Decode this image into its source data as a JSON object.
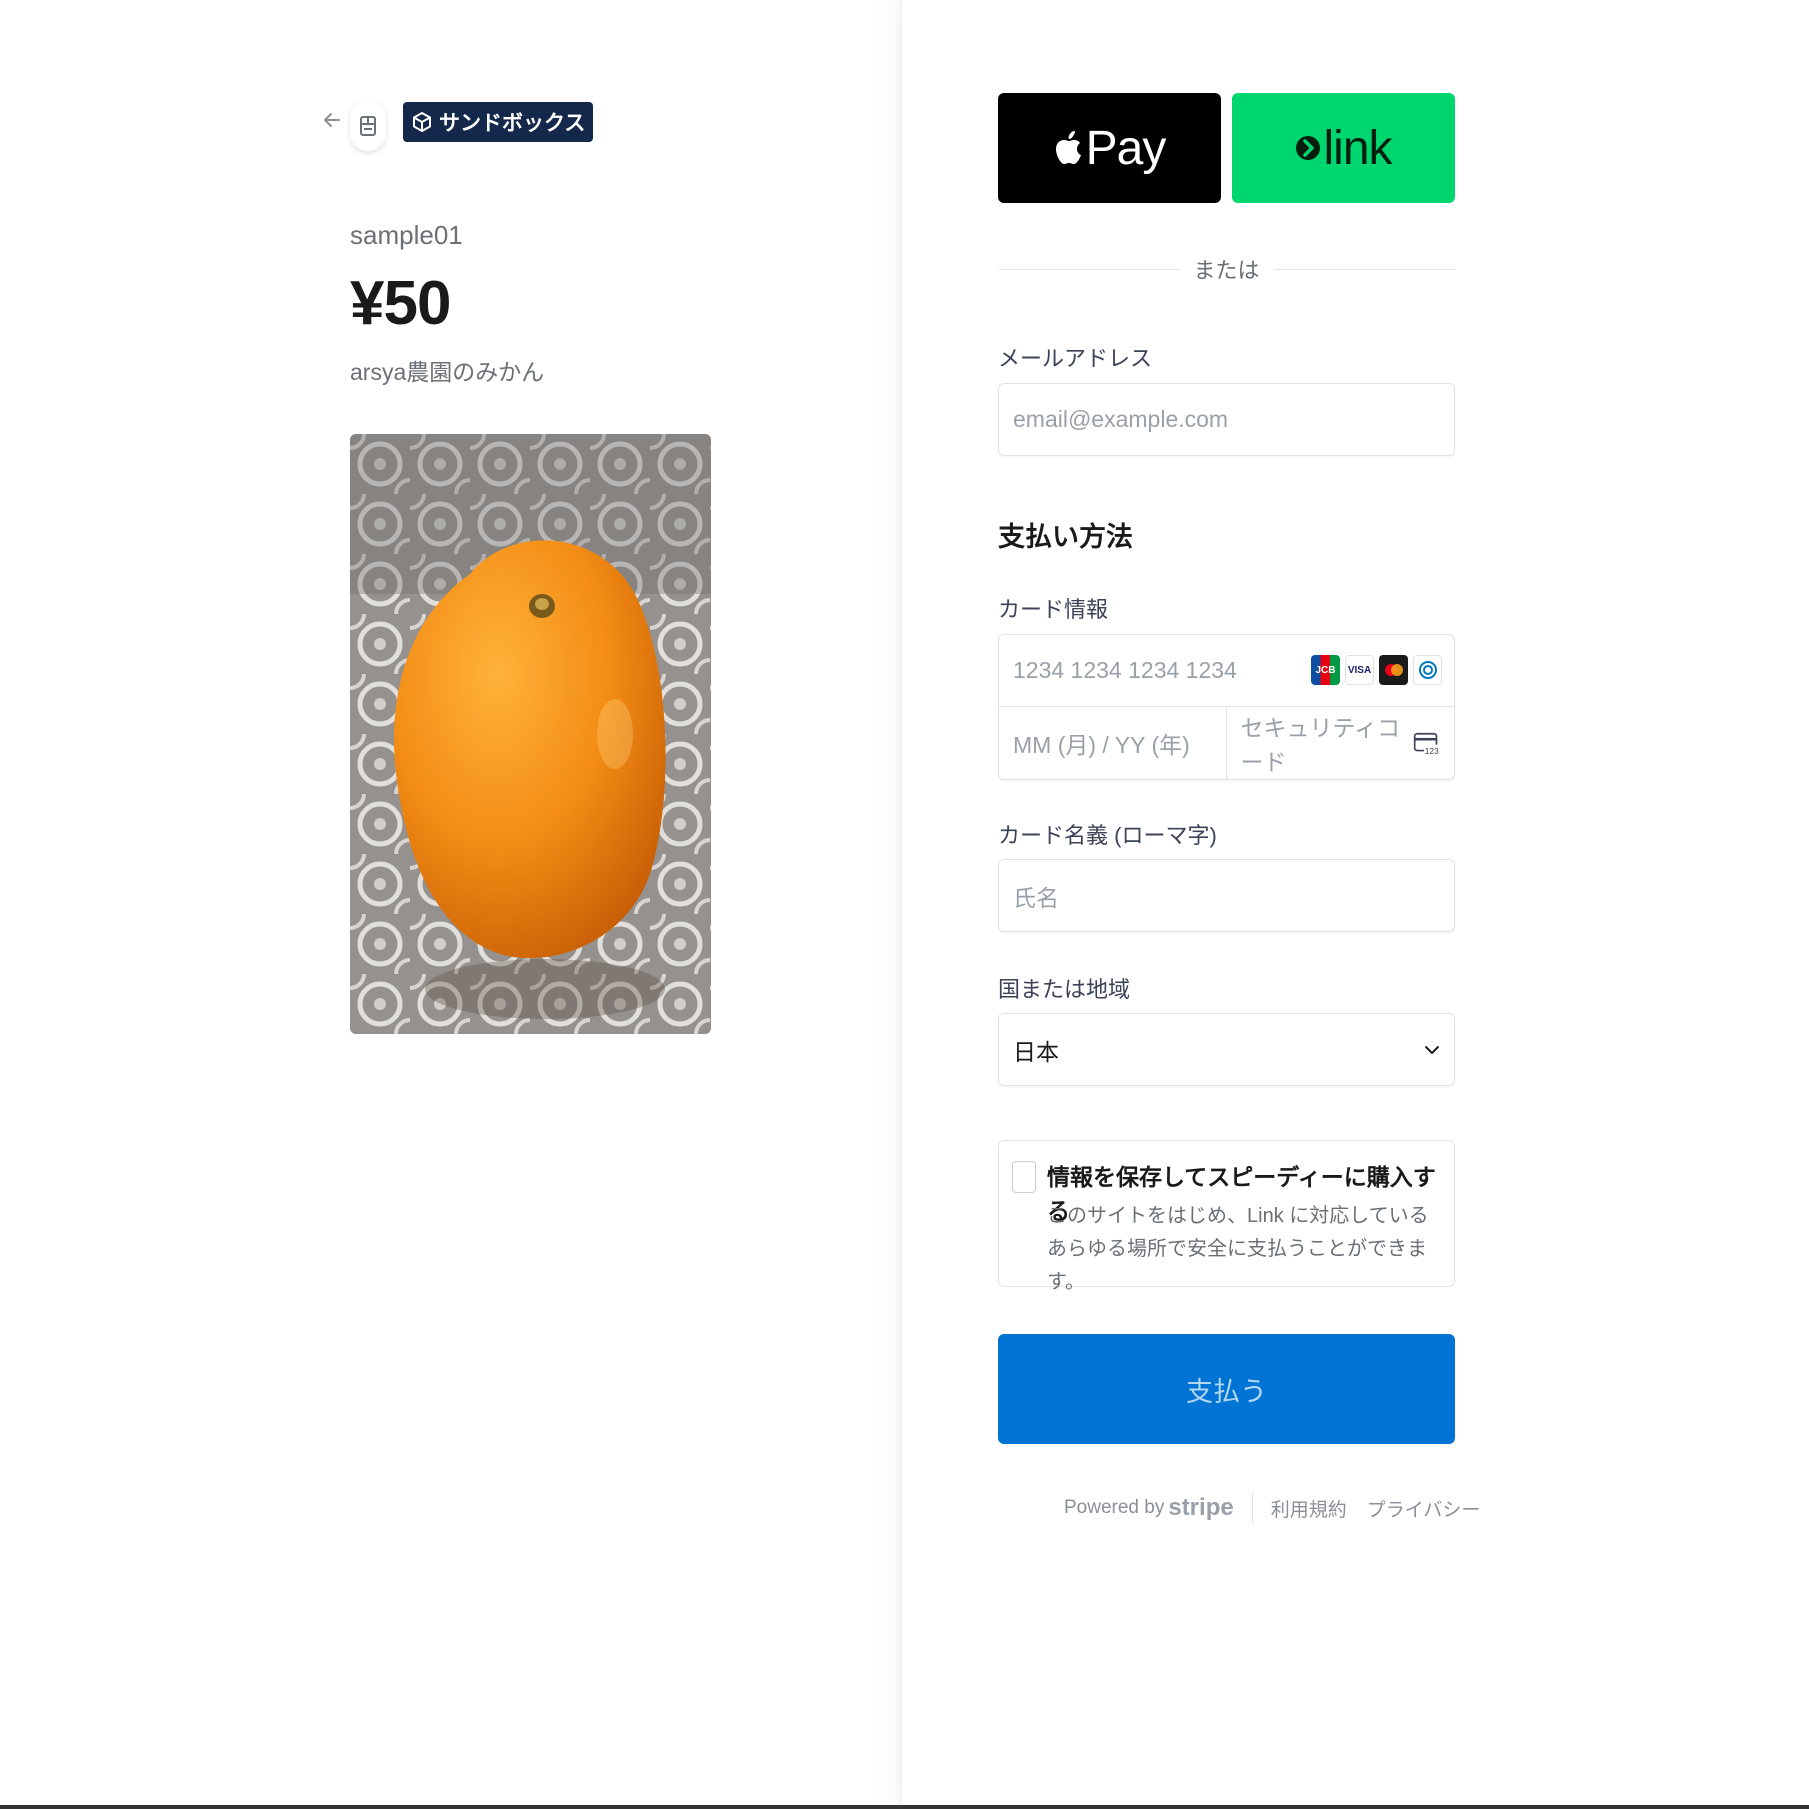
{
  "header": {
    "back_icon": "arrow-left-icon",
    "merchant_icon": "store-icon",
    "sandbox_label": "サンドボックス",
    "sandbox_badge_color": "#13284a"
  },
  "product": {
    "name": "sample01",
    "price": "¥50",
    "description": "arsya農園のみかん",
    "image": "orange-photo"
  },
  "wallets": {
    "apple_pay_label": "Pay",
    "link_label": "link",
    "apple_pay_color": "#000000",
    "link_color": "#00d66f"
  },
  "divider_text": "または",
  "email": {
    "label": "メールアドレス",
    "placeholder": "email@example.com"
  },
  "payment": {
    "title": "支払い方法",
    "card_label": "カード情報",
    "card_number_placeholder": "1234 1234 1234 1234",
    "card_brands": [
      "JCB",
      "VISA",
      "Mastercard",
      "Diners Club"
    ],
    "expiry_placeholder": "MM (月) / YY (年)",
    "cvc_placeholder": "セキュリティコード",
    "cvc_icon_text": "123",
    "cardholder_label": "カード名義 (ローマ字)",
    "cardholder_placeholder": "氏名",
    "country_label": "国または地域",
    "country_value": "日本"
  },
  "save_info": {
    "title": "情報を保存してスピーディーに購入する",
    "description": "このサイトをはじめ、Link に対応しているあらゆる場所で安全に支払うことができます。",
    "checked": false
  },
  "pay_button": {
    "label": "支払う",
    "color": "#0074d4"
  },
  "footer": {
    "powered_by": "Powered by",
    "stripe": "stripe",
    "terms": "利用規約",
    "privacy": "プライバシー"
  }
}
